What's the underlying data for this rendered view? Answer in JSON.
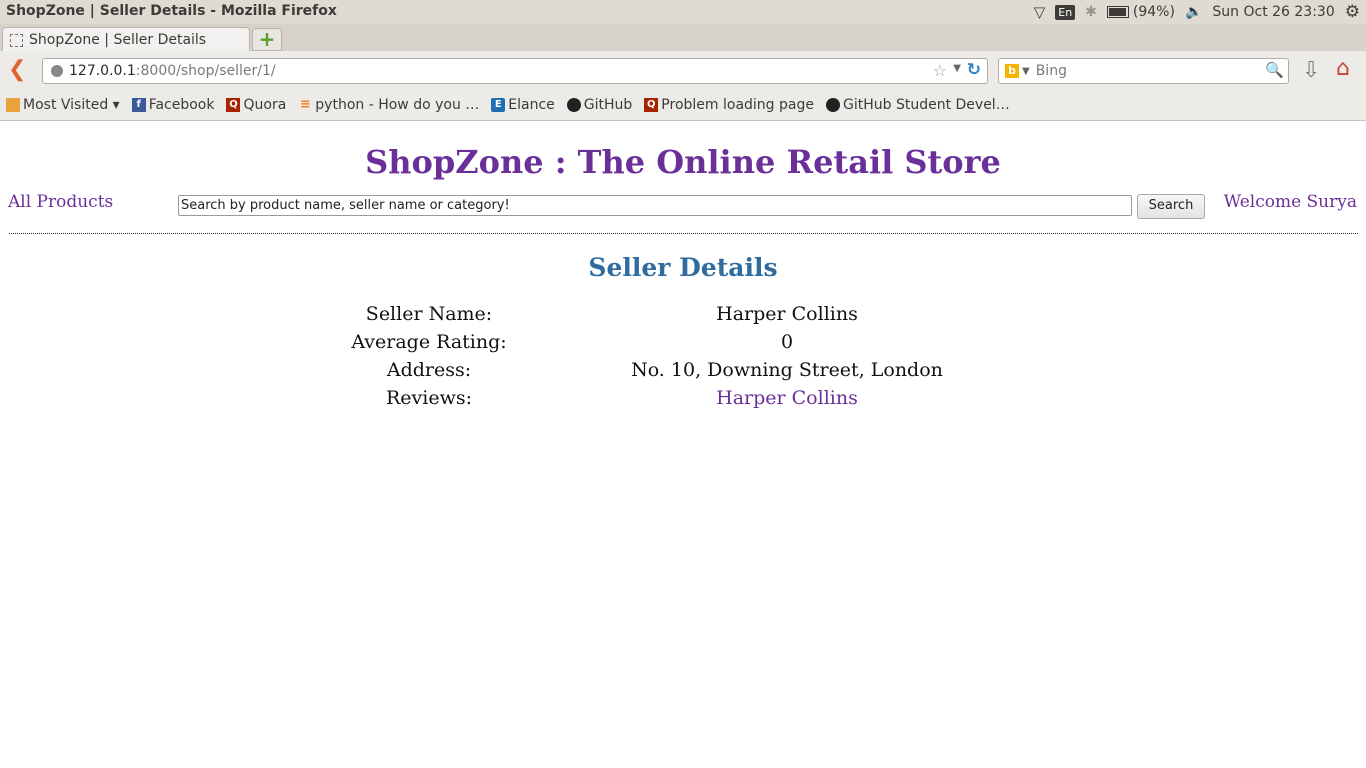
{
  "window": {
    "title": "ShopZone | Seller Details - Mozilla Firefox"
  },
  "tray": {
    "lang": "En",
    "battery": "(94%)",
    "clock": "Sun Oct 26 23:30"
  },
  "tabs": [
    {
      "label": "ShopZone | Seller Details"
    }
  ],
  "url": {
    "host": "127.0.0.1",
    "rest": ":8000/shop/seller/1/"
  },
  "search": {
    "engine": "Bing",
    "placeholder": "Bing"
  },
  "bookmarks": [
    {
      "label": "Most Visited ▾",
      "icon": "folder-icon"
    },
    {
      "label": "Facebook",
      "icon": "facebook-icon"
    },
    {
      "label": "Quora",
      "icon": "quora-icon"
    },
    {
      "label": "python - How do you …",
      "icon": "stackoverflow-icon"
    },
    {
      "label": "Elance",
      "icon": "elance-icon"
    },
    {
      "label": "GitHub",
      "icon": "github-icon"
    },
    {
      "label": "Problem loading page",
      "icon": "quora-icon"
    },
    {
      "label": "GitHub Student Devel…",
      "icon": "github-icon"
    }
  ],
  "site": {
    "title": "ShopZone : The Online Retail Store",
    "nav_all_products": "All Products",
    "welcome": "Welcome Surya",
    "search_value": "Search by product name, seller name or category!",
    "search_button": "Search"
  },
  "seller": {
    "heading": "Seller Details",
    "rows": [
      {
        "label": "Seller Name:",
        "value": "Harper Collins"
      },
      {
        "label": "Average Rating:",
        "value": "0"
      },
      {
        "label": "Address:",
        "value": "No. 10, Downing Street, London"
      },
      {
        "label": "Reviews:",
        "value": "Harper Collins"
      }
    ]
  },
  "colors": {
    "brand": "#6a2f99",
    "section": "#2f6b9e"
  }
}
